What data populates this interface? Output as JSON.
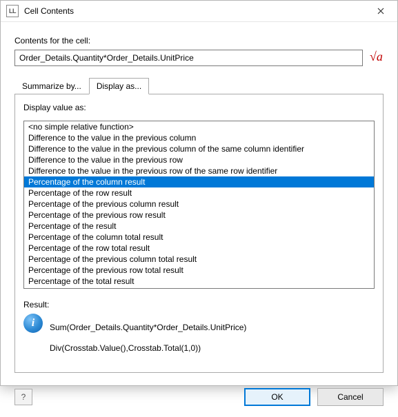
{
  "window": {
    "app_icon_text": "LL",
    "title": "Cell Contents"
  },
  "labels": {
    "contents_for_cell": "Contents for the cell:",
    "display_value_as": "Display value as:",
    "result": "Result:"
  },
  "expression": {
    "value": "Order_Details.Quantity*Order_Details.UnitPrice"
  },
  "tabs": {
    "summarize": "Summarize by...",
    "display": "Display as..."
  },
  "display_options": {
    "items": [
      "<no simple relative function>",
      "Difference to the value in the previous column",
      "Difference to the value in the previous column of the same column identifier",
      "Difference to the value in the previous row",
      "Difference to the value in the previous row of the same row identifier",
      "Percentage of the column result",
      "Percentage of the row result",
      "Percentage of the previous column result",
      "Percentage of the previous row result",
      "Percentage of the result",
      "Percentage of the column total result",
      "Percentage of the row total result",
      "Percentage of the previous column total result",
      "Percentage of the previous row total result",
      "Percentage of the total result"
    ],
    "selected_index": 5
  },
  "result_text": {
    "line1": "Sum(Order_Details.Quantity*Order_Details.UnitPrice)",
    "line2": "Div(Crosstab.Value(),Crosstab.Total(1,0))"
  },
  "buttons": {
    "ok": "OK",
    "cancel": "Cancel",
    "help_symbol": "?"
  },
  "icons": {
    "sqrt": "√a"
  }
}
